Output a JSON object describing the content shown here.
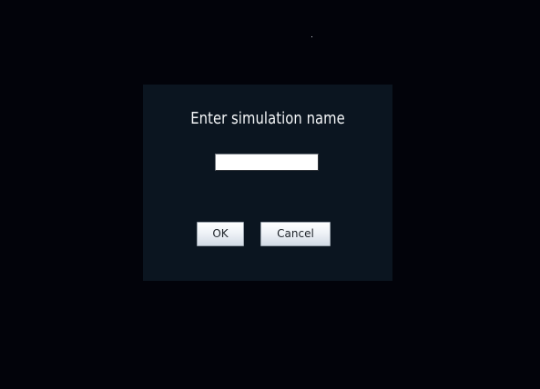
{
  "dialog": {
    "title": "Enter simulation name",
    "input_value": "",
    "input_placeholder": "",
    "ok_label": "OK",
    "cancel_label": "Cancel"
  },
  "colors": {
    "background": "#02030a",
    "dialog_background": "#0b1520",
    "title_text": "#f4f6f8"
  }
}
